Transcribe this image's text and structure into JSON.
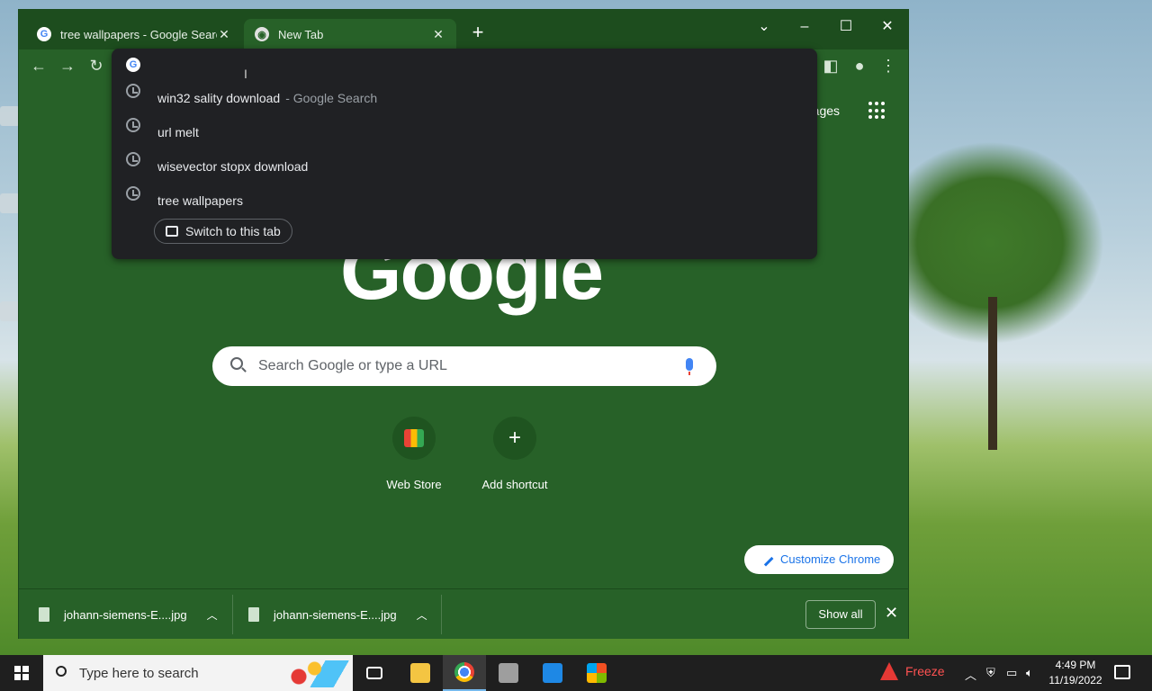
{
  "browser": {
    "tabs": [
      {
        "title": "tree wallpapers - Google Search",
        "favicon": "google-g-icon",
        "active": false
      },
      {
        "title": "New Tab",
        "favicon": "chrome-icon",
        "active": true
      }
    ]
  },
  "omnibox": {
    "value": "",
    "suggestions": [
      {
        "text": "win32 sality download",
        "sub": "- Google Search",
        "icon": "history-clock-icon"
      },
      {
        "text": "url melt",
        "sub": "",
        "icon": "history-clock-icon"
      },
      {
        "text": "wisevector stopx download",
        "sub": "",
        "icon": "history-clock-icon"
      },
      {
        "text": "tree wallpapers",
        "sub": "",
        "icon": "history-clock-icon"
      }
    ],
    "switch_tab_label": "Switch to this tab"
  },
  "ntp": {
    "images_link": "mages",
    "logo": "Google",
    "search_placeholder": "Search Google or type a URL",
    "shortcuts": [
      {
        "label": "Web Store",
        "icon": "web-store-icon"
      },
      {
        "label": "Add shortcut",
        "icon": "plus-icon"
      }
    ],
    "customize_label": "Customize Chrome"
  },
  "downloads": {
    "items": [
      {
        "filename": "johann-siemens-E....jpg"
      },
      {
        "filename": "johann-siemens-E....jpg"
      }
    ],
    "show_all_label": "Show all"
  },
  "taskbar": {
    "search_placeholder": "Type here to search",
    "freeze_label": "Freeze",
    "time": "4:49 PM",
    "date": "11/19/2022"
  },
  "colors": {
    "theme_green": "#276128",
    "popup_bg": "#202124",
    "accent_blue": "#1a73e8"
  }
}
